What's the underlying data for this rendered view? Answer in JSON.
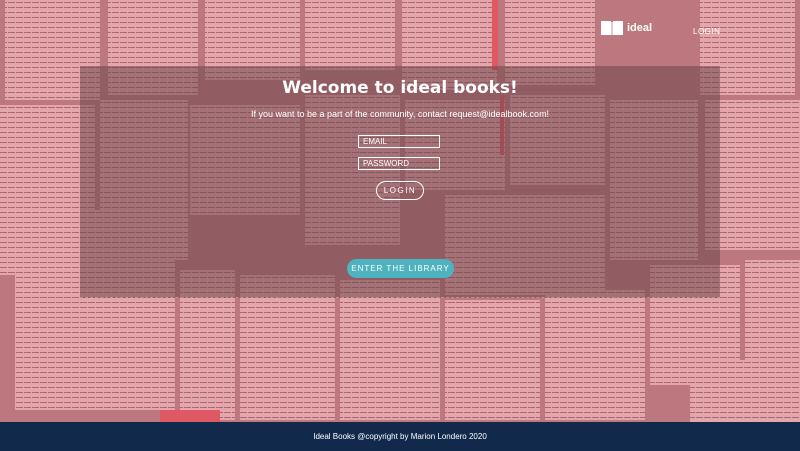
{
  "brand": {
    "logo_text": "ideal"
  },
  "nav": {
    "login_label": "LOGIN"
  },
  "hero": {
    "title": "Welcome to ideal books!",
    "subtitle": "If you want to be a part of the community, contact request@idealbook.com!"
  },
  "form": {
    "email_placeholder": "EMAIL",
    "password_placeholder": "PASSWORD",
    "login_label": "LOGIN"
  },
  "cta": {
    "enter_label": "ENTER THE LIBRARY"
  },
  "footer": {
    "copyright": "Ideal Books @copyright by Marion Londero 2020"
  },
  "colors": {
    "accent": "#4fb3bf",
    "footer_bg": "#11294b",
    "background_tint": "#c98f93"
  },
  "icons": {
    "logo": "book-icon"
  }
}
